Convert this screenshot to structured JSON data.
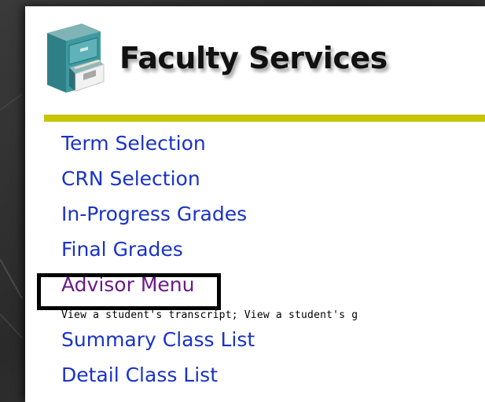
{
  "header": {
    "title": "Faculty Services",
    "icon": "file-cabinet-icon"
  },
  "colors": {
    "link": "#1a33c8",
    "visited_link": "#6a1b8a",
    "rule": "#c9c400",
    "highlight_border": "#000000"
  },
  "menu": {
    "items": [
      {
        "label": "Term Selection"
      },
      {
        "label": "CRN Selection"
      },
      {
        "label": "In-Progress Grades"
      },
      {
        "label": "Final Grades"
      },
      {
        "label": "Advisor Menu",
        "description": "View a student's transcript; View a student's g"
      },
      {
        "label": "Summary Class List"
      },
      {
        "label": "Detail Class List"
      }
    ]
  }
}
